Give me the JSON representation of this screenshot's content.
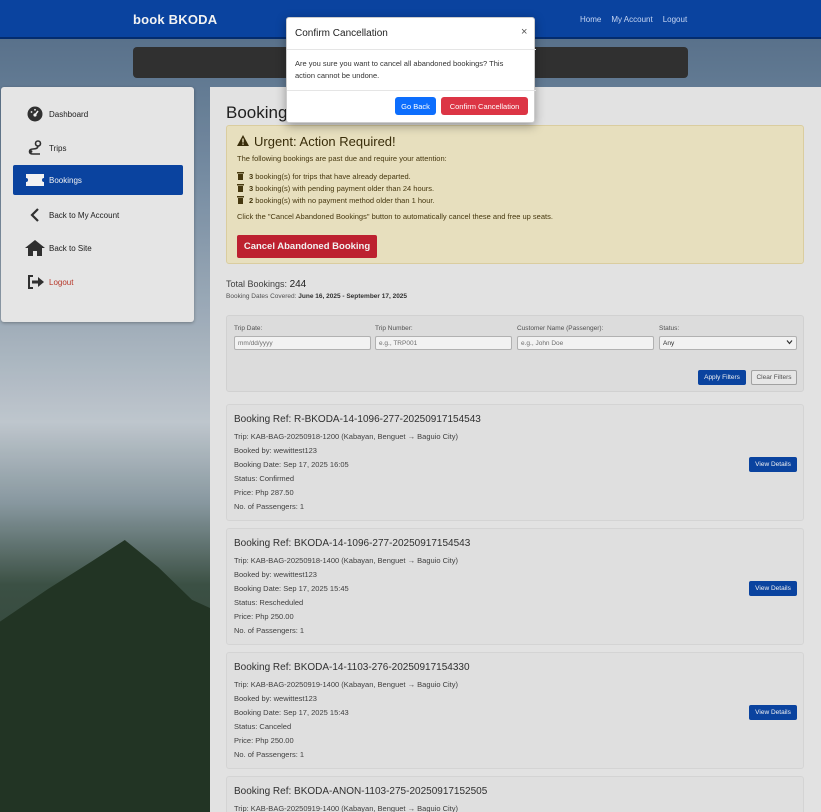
{
  "navbar": {
    "brand": "book BKODA",
    "links": [
      "Home",
      "My Account",
      "Logout"
    ]
  },
  "sidebar": {
    "items": [
      {
        "label": "Dashboard"
      },
      {
        "label": "Trips"
      },
      {
        "label": "Bookings"
      },
      {
        "label": "Back to My Account"
      },
      {
        "label": "Back to Site"
      },
      {
        "label": "Logout"
      }
    ]
  },
  "page": {
    "title": "Bookings"
  },
  "alert": {
    "title": "Urgent: Action Required!",
    "intro": "The following bookings are past due and require your attention:",
    "items": [
      {
        "count": "3",
        "text": "booking(s) for trips that have already departed."
      },
      {
        "count": "3",
        "text": "booking(s) with pending payment older than 24 hours."
      },
      {
        "count": "2",
        "text": "booking(s) with no payment method older than 1 hour."
      }
    ],
    "note": "Click the \"Cancel Abandoned Bookings\" button to automatically cancel these and free up seats.",
    "button": "Cancel Abandoned Booking"
  },
  "summary": {
    "total_label": "Total Bookings:",
    "total_value": "244",
    "covered_label": "Booking Dates Covered:",
    "covered_value": "June 16, 2025 - September 17, 2025"
  },
  "filters": {
    "trip_date": {
      "label": "Trip Date:",
      "placeholder": "mm/dd/yyyy"
    },
    "trip_number": {
      "label": "Trip Number:",
      "placeholder": "e.g., TRP001"
    },
    "customer": {
      "label": "Customer Name (Passenger):",
      "placeholder": "e.g., John Doe"
    },
    "status": {
      "label": "Status:",
      "value": "Any"
    },
    "apply": "Apply Filters",
    "clear": "Clear Filters"
  },
  "bookings": [
    {
      "ref": "Booking Ref: R-BKODA-14-1096-277-20250917154543",
      "trip": "Trip: KAB-BAG-20250918-1200 (Kabayan, Benguet → Baguio City)",
      "booked_by": "Booked by: wewittest123",
      "date": "Booking Date: Sep 17, 2025 16:05",
      "status": "Status: Confirmed",
      "price": "Price: Php 287.50",
      "passengers": "No. of Passengers: 1",
      "button": "View Details"
    },
    {
      "ref": "Booking Ref: BKODA-14-1096-277-20250917154543",
      "trip": "Trip: KAB-BAG-20250918-1400 (Kabayan, Benguet → Baguio City)",
      "booked_by": "Booked by: wewittest123",
      "date": "Booking Date: Sep 17, 2025 15:45",
      "status": "Status: Rescheduled",
      "price": "Price: Php 250.00",
      "passengers": "No. of Passengers: 1",
      "button": "View Details"
    },
    {
      "ref": "Booking Ref: BKODA-14-1103-276-20250917154330",
      "trip": "Trip: KAB-BAG-20250919-1400 (Kabayan, Benguet → Baguio City)",
      "booked_by": "Booked by: wewittest123",
      "date": "Booking Date: Sep 17, 2025 15:43",
      "status": "Status: Canceled",
      "price": "Price: Php 250.00",
      "passengers": "No. of Passengers: 1",
      "button": "View Details"
    },
    {
      "ref": "Booking Ref: BKODA-ANON-1103-275-20250917152505",
      "trip": "Trip: KAB-BAG-20250919-1400 (Kabayan, Benguet → Baguio City)"
    }
  ],
  "modal": {
    "title": "Confirm Cancellation",
    "close": "×",
    "body": "Are you sure you want to cancel all abandoned bookings? This action cannot be undone.",
    "back": "Go Back",
    "confirm": "Confirm Cancellation"
  },
  "colors": {
    "primary": "#0b47a8",
    "danger": "#c82333",
    "alert_bg": "#f4ebc9"
  },
  "icons": [
    "tachometer-icon",
    "route-icon",
    "ticket-icon",
    "chevron-left-icon",
    "home-icon",
    "sign-out-icon",
    "warning-icon",
    "trash-icon",
    "chevron-down-icon",
    "close-icon"
  ]
}
